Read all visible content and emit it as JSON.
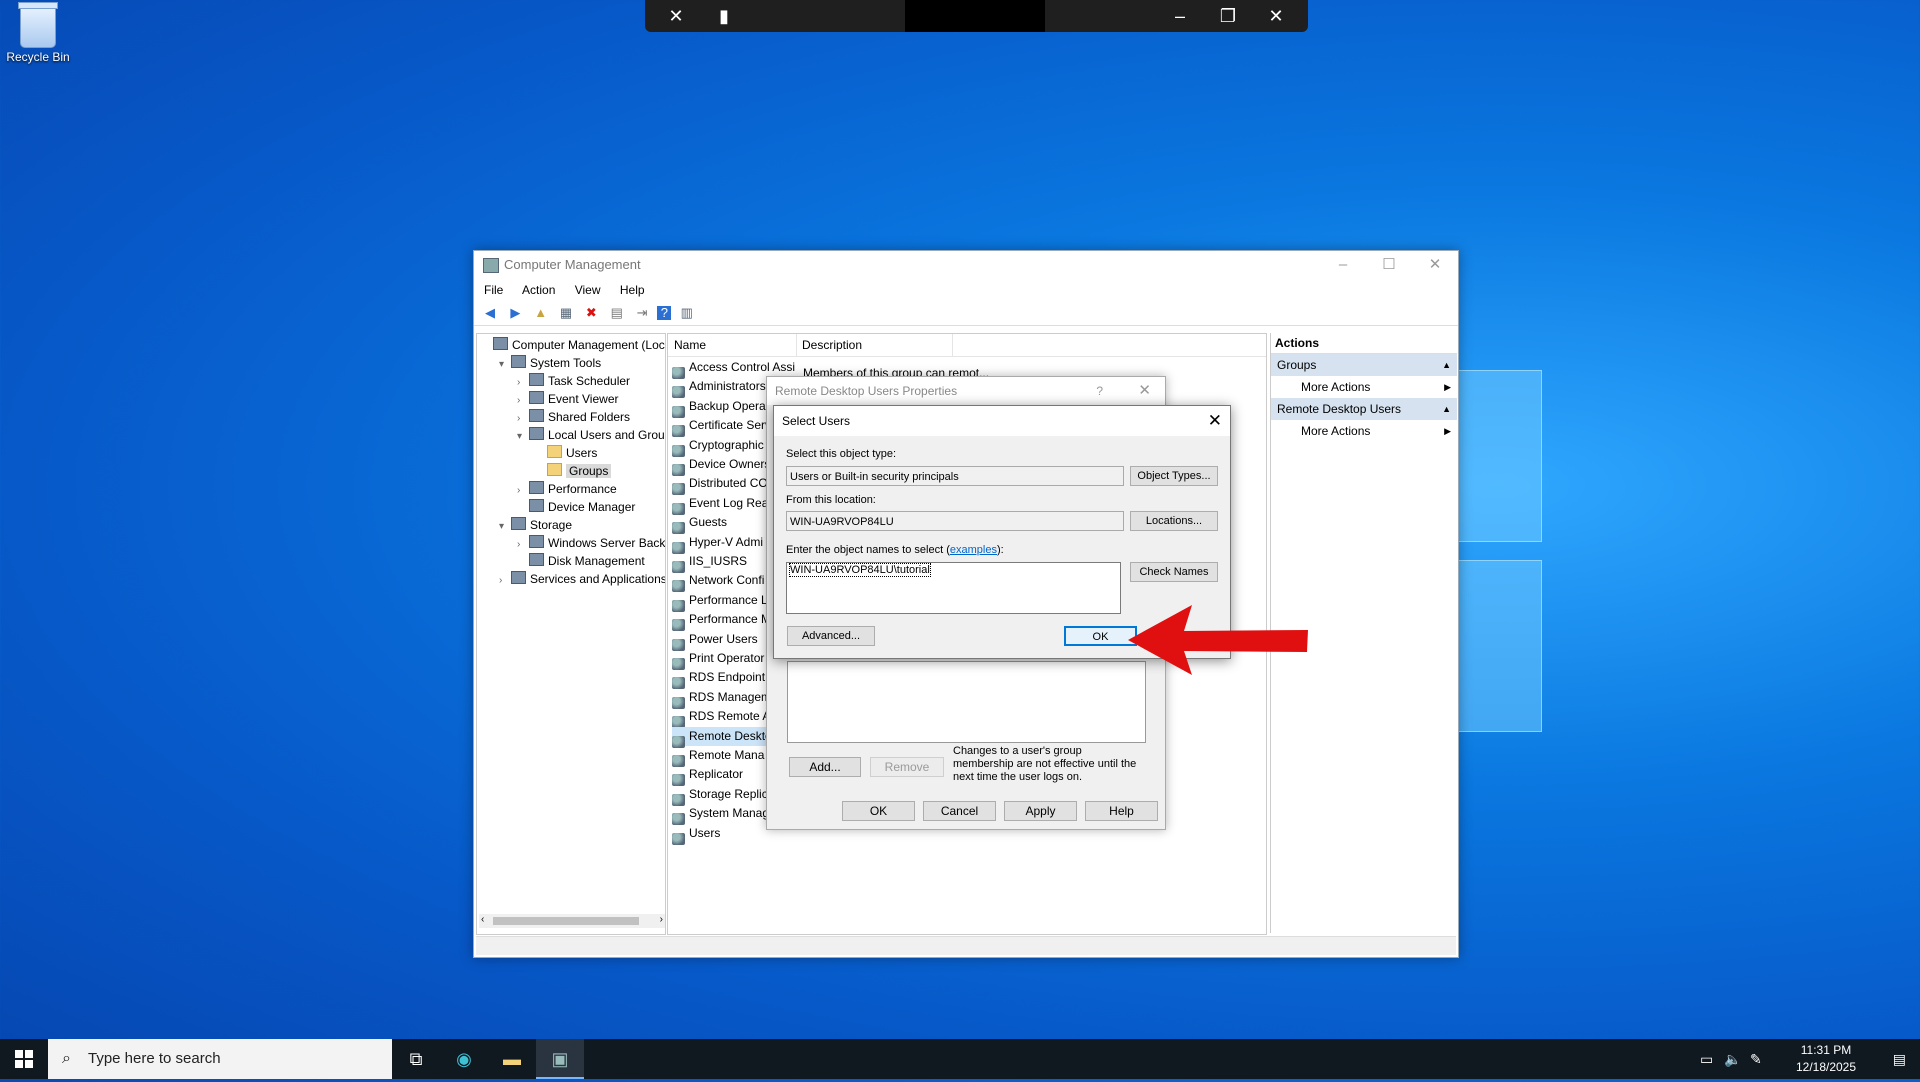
{
  "desktop": {
    "recycle_bin_label": "Recycle Bin"
  },
  "computer_management": {
    "title": "Computer Management",
    "menu": [
      "File",
      "Action",
      "View",
      "Help"
    ],
    "tree": [
      {
        "label": "Computer Management (Local",
        "level": 0,
        "expander": "",
        "icon": "computer-icon"
      },
      {
        "label": "System Tools",
        "level": 1,
        "expander": "▾",
        "icon": "tools-icon"
      },
      {
        "label": "Task Scheduler",
        "level": 2,
        "expander": "›",
        "icon": "clock-icon"
      },
      {
        "label": "Event Viewer",
        "level": 2,
        "expander": "›",
        "icon": "event-viewer-icon"
      },
      {
        "label": "Shared Folders",
        "level": 2,
        "expander": "›",
        "icon": "shared-folder-icon"
      },
      {
        "label": "Local Users and Groups",
        "level": 2,
        "expander": "▾",
        "icon": "users-icon"
      },
      {
        "label": "Users",
        "level": 3,
        "expander": "",
        "icon": "folder-icon"
      },
      {
        "label": "Groups",
        "level": 3,
        "expander": "",
        "icon": "folder-icon",
        "selected": true
      },
      {
        "label": "Performance",
        "level": 2,
        "expander": "›",
        "icon": "performance-icon"
      },
      {
        "label": "Device Manager",
        "level": 2,
        "expander": "",
        "icon": "device-manager-icon"
      },
      {
        "label": "Storage",
        "level": 1,
        "expander": "▾",
        "icon": "storage-icon"
      },
      {
        "label": "Windows Server Backup",
        "level": 2,
        "expander": "›",
        "icon": "backup-icon"
      },
      {
        "label": "Disk Management",
        "level": 2,
        "expander": "",
        "icon": "disk-icon"
      },
      {
        "label": "Services and Applications",
        "level": 1,
        "expander": "›",
        "icon": "services-icon"
      }
    ],
    "list_headers": {
      "name": "Name",
      "description": "Description"
    },
    "groups": [
      {
        "name": "Access Control Assist...",
        "desc": "Members of this group can remot..."
      },
      {
        "name": "Administrators",
        "desc": ""
      },
      {
        "name": "Backup Operat",
        "desc": ""
      },
      {
        "name": "Certificate Serv",
        "desc": ""
      },
      {
        "name": "Cryptographic",
        "desc": ""
      },
      {
        "name": "Device Owners",
        "desc": ""
      },
      {
        "name": "Distributed CO",
        "desc": ""
      },
      {
        "name": "Event Log Rea",
        "desc": ""
      },
      {
        "name": "Guests",
        "desc": ""
      },
      {
        "name": "Hyper-V Admi",
        "desc": ""
      },
      {
        "name": "IIS_IUSRS",
        "desc": ""
      },
      {
        "name": "Network Confi",
        "desc": ""
      },
      {
        "name": "Performance L",
        "desc": ""
      },
      {
        "name": "Performance M",
        "desc": ""
      },
      {
        "name": "Power Users",
        "desc": ""
      },
      {
        "name": "Print Operator",
        "desc": ""
      },
      {
        "name": "RDS Endpoint",
        "desc": ""
      },
      {
        "name": "RDS Managem",
        "desc": ""
      },
      {
        "name": "RDS Remote A",
        "desc": ""
      },
      {
        "name": "Remote Deskto",
        "desc": "",
        "selected": true
      },
      {
        "name": "Remote Mana",
        "desc": ""
      },
      {
        "name": "Replicator",
        "desc": ""
      },
      {
        "name": "Storage Replic",
        "desc": ""
      },
      {
        "name": "System Manag",
        "desc": ""
      },
      {
        "name": "Users",
        "desc": ""
      }
    ],
    "actions": {
      "header": "Actions",
      "group1": "Groups",
      "group1_action": "More Actions",
      "group2": "Remote Desktop Users",
      "group2_action": "More Actions"
    }
  },
  "properties_dialog": {
    "title": "Remote Desktop Users Properties",
    "help_glyph": "?",
    "add_label": "Add...",
    "remove_label": "Remove",
    "note": "Changes to a user's group membership are not effective until the next time the user logs on.",
    "ok_label": "OK",
    "cancel_label": "Cancel",
    "apply_label": "Apply",
    "help_label": "Help"
  },
  "select_users": {
    "title": "Select Users",
    "object_type_label": "Select this object type:",
    "object_type_value": "Users or Built-in security principals",
    "object_types_button": "Object Types...",
    "location_label": "From this location:",
    "location_value": "WIN-UA9RVOP84LU",
    "locations_button": "Locations...",
    "names_label_prefix": "Enter the object names to select (",
    "names_label_link": "examples",
    "names_label_suffix": "):",
    "names_value": "WIN-UA9RVOP84LU\\tutorial",
    "check_names_button": "Check Names",
    "advanced_button": "Advanced...",
    "ok_button": "OK"
  },
  "taskbar": {
    "search_placeholder": "Type here to search",
    "time": "11:31 PM",
    "date": "12/18/2025"
  },
  "colors": {
    "accent": "#0078d7",
    "arrow": "#e01010",
    "selection": "#cce4f7"
  }
}
